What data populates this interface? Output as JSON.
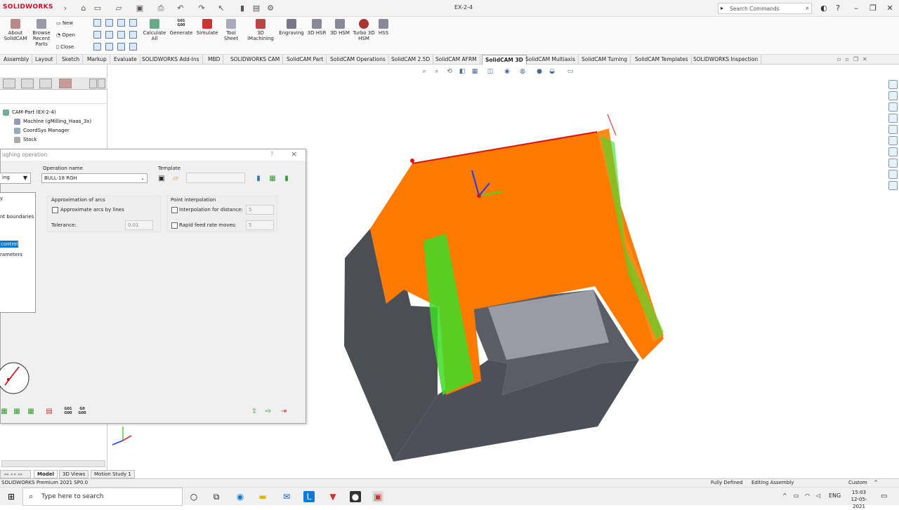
{
  "app": {
    "brand": "SOLIDWORKS",
    "document_title": "EX-2-4",
    "search_placeholder": "Search Commands"
  },
  "ribbon": {
    "buttons": [
      {
        "label": "About SolidCAM"
      },
      {
        "label": "Browse Recent Parts"
      },
      {
        "label": "Calculate All"
      },
      {
        "label": "Generate"
      },
      {
        "label": "Simulate"
      },
      {
        "label": "Tool Sheet"
      },
      {
        "label": "3D iMachining"
      },
      {
        "label": "Engraving"
      },
      {
        "label": "3D HSR"
      },
      {
        "label": "3D HSM"
      },
      {
        "label": "Turbo 3D HSM"
      },
      {
        "label": "HSS"
      }
    ],
    "file_new": "New",
    "file_open": "Open",
    "file_close": "Close",
    "g_code": "G01 G00"
  },
  "tabs": [
    "Assembly",
    "Layout",
    "Sketch",
    "Markup",
    "Evaluate",
    "SOLIDWORKS Add-Ins",
    "MBD",
    "SOLIDWORKS CAM",
    "SolidCAM Part",
    "SolidCAM Operations",
    "SolidCAM 2.5D",
    "SolidCAM AFRM",
    "SolidCAM 3D",
    "SolidCAM Multiaxis",
    "SolidCAM Turning",
    "SolidCAM Templates",
    "SOLIDWORKS Inspection"
  ],
  "tree": {
    "items": [
      {
        "label": "CAM-Part (EX-2-4)"
      },
      {
        "label": "Machine (gMilling_Haas_3x)"
      },
      {
        "label": "CoordSys Manager"
      },
      {
        "label": "Stock"
      }
    ]
  },
  "dialog": {
    "title": "ughing operation",
    "type_value": "ing",
    "operation_name_label": "Operation name",
    "operation_name_value": "BULL-18 RGH",
    "template_label": "Template",
    "template_value": "",
    "left_list": [
      "y",
      "nt boundaries",
      "control",
      "rameters"
    ],
    "arcs_group": "Approximation of arcs",
    "approx_arcs_label": "Approximate arcs by lines",
    "tolerance_label": "Tolerance:",
    "tolerance_value": "0.01",
    "point_group": "Point interpolation",
    "interp_distance_label": "Interpolation for distance:",
    "interp_distance_value": "5",
    "rapid_feed_label": "Rapid feed rate moves:",
    "rapid_feed_value": "5",
    "g_code": "G01 G00",
    "g_code2": "G0 G00",
    "help": "?",
    "close": "×"
  },
  "bottom_tabs": [
    "Model",
    "3D Views",
    "Motion Study 1"
  ],
  "status": {
    "left": "SOLIDWORKS Premium 2021 SP0.0",
    "defined": "Fully Defined",
    "mode": "Editing Assembly",
    "units": "Custom"
  },
  "taskbar": {
    "search_placeholder": "Type here to search",
    "lang": "ENG",
    "time": "15:03",
    "date": "12-05-2021"
  },
  "colors": {
    "toolpath_orange": "#ff7a00",
    "toolpath_green": "#3ddc28",
    "part_gray": "#4b4e55",
    "part_face": "#9a9ca5",
    "brand_red": "#c8102e",
    "active_sel": "#0078d7"
  }
}
